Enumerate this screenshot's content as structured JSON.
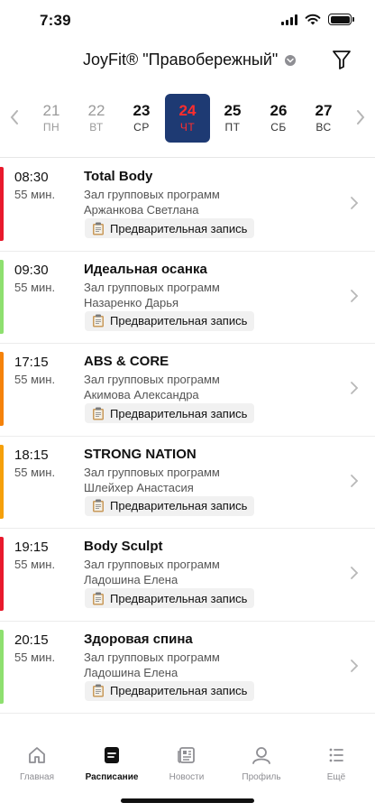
{
  "status_bar": {
    "time": "7:39"
  },
  "header": {
    "club_name": "JoyFit® \"Правобережный\""
  },
  "week": {
    "days": [
      {
        "num": "21",
        "weekday": "ПН",
        "state": "past"
      },
      {
        "num": "22",
        "weekday": "ВТ",
        "state": "past"
      },
      {
        "num": "23",
        "weekday": "СР",
        "state": "future"
      },
      {
        "num": "24",
        "weekday": "ЧТ",
        "state": "active"
      },
      {
        "num": "25",
        "weekday": "ПТ",
        "state": "future"
      },
      {
        "num": "26",
        "weekday": "СБ",
        "state": "future"
      },
      {
        "num": "27",
        "weekday": "ВС",
        "state": "future"
      }
    ]
  },
  "schedule": [
    {
      "time": "08:30",
      "duration": "55 мин.",
      "title": "Total Body",
      "hall": "Зал групповых программ",
      "trainer": "Аржанкова  Светлана",
      "tag": "Предварительная запись",
      "color": "#e8192c"
    },
    {
      "time": "09:30",
      "duration": "55 мин.",
      "title": "Идеальная осанка",
      "hall": "Зал групповых программ",
      "trainer": "Назаренко Дарья",
      "tag": "Предварительная запись",
      "color": "#8ee06f"
    },
    {
      "time": "17:15",
      "duration": "55 мин.",
      "title": "ABS & CORE",
      "hall": "Зал групповых программ",
      "trainer": "Акимова  Александра",
      "tag": "Предварительная запись",
      "color": "#f5820a"
    },
    {
      "time": "18:15",
      "duration": "55 мин.",
      "title": "STRONG NATION",
      "hall": "Зал групповых программ",
      "trainer": "Шлейхер Анастасия",
      "tag": "Предварительная запись",
      "color": "#f5a00a"
    },
    {
      "time": "19:15",
      "duration": "55 мин.",
      "title": "Body Sculpt",
      "hall": "Зал групповых программ",
      "trainer": "Ладошина  Елена",
      "tag": "Предварительная запись",
      "color": "#e8192c"
    },
    {
      "time": "20:15",
      "duration": "55 мин.",
      "title": "Здоровая спина",
      "hall": "Зал групповых программ",
      "trainer": "Ладошина  Елена",
      "tag": "Предварительная запись",
      "color": "#8ee06f"
    }
  ],
  "tabbar": {
    "home": "Главная",
    "schedule": "Расписание",
    "news": "Новости",
    "profile": "Профиль",
    "more": "Ещё",
    "active": "schedule"
  },
  "colors": {
    "accent": "#1e3a73",
    "active_day_text": "#ff2d2d"
  }
}
